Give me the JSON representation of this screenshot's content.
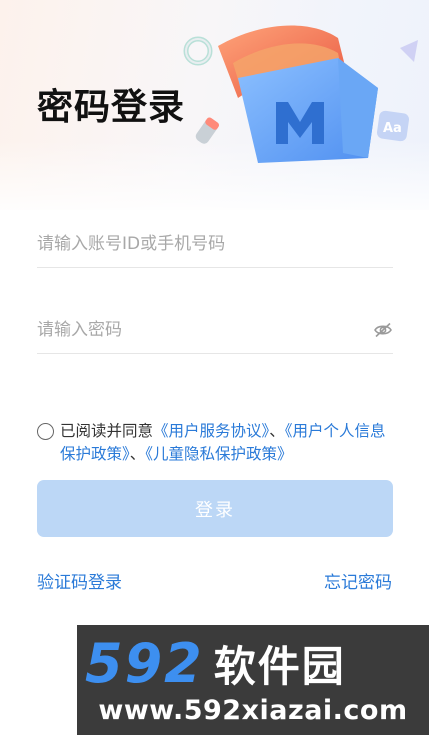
{
  "page": {
    "title": "密码登录"
  },
  "form": {
    "account_placeholder": "请输入账号ID或手机号码",
    "password_placeholder": "请输入密码",
    "password_toggle_icon": "eye-closed-icon"
  },
  "agreement": {
    "prefix": "已阅读并同意",
    "user_agreement": "《用户服务协议》",
    "sep1": "、",
    "privacy_policy": "《用户个人信息保护政策》",
    "sep2": "、",
    "child_policy": "《儿童隐私保护政策》"
  },
  "actions": {
    "login_label": "登录",
    "sms_login_label": "验证码登录",
    "forgot_password_label": "忘记密码"
  },
  "watermark": {
    "number": "592",
    "brand": "软件园",
    "url": "www.592xiazai.com"
  },
  "colors": {
    "accent": "#2a7ad8",
    "button_disabled": "#bcd7f6",
    "watermark_bg": "#3b3b3b",
    "watermark_blue": "#3d8ff0"
  }
}
